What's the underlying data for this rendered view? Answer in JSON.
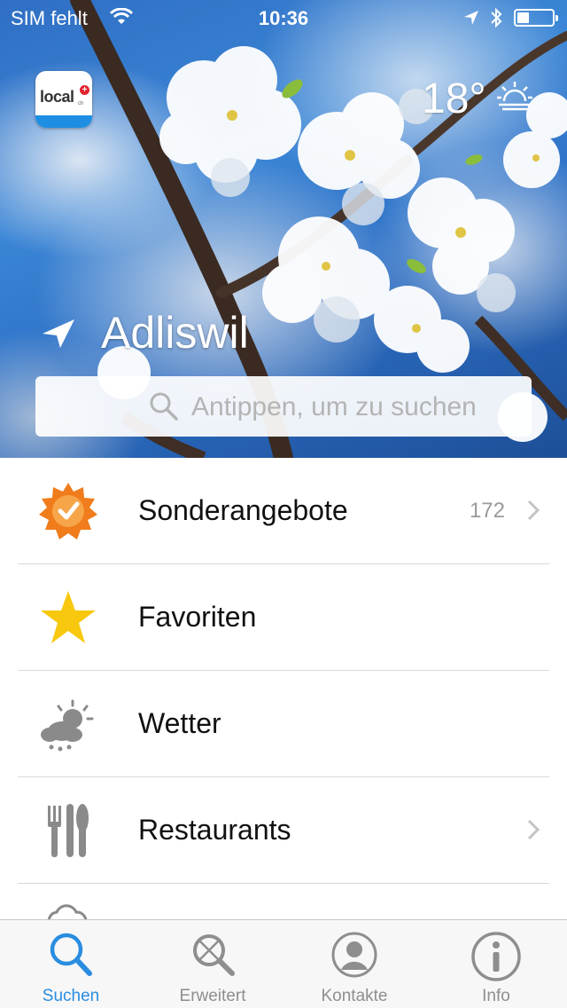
{
  "status_bar": {
    "carrier": "SIM fehlt",
    "time": "10:36",
    "battery_level": 0.35
  },
  "logo": {
    "text": "local",
    "sub": "ch"
  },
  "weather": {
    "temperature": "18°",
    "icon": "sunrise-icon"
  },
  "location": {
    "name": "Adliswil",
    "icon": "location-arrow-icon"
  },
  "search": {
    "placeholder": "Antippen, um zu suchen",
    "icon": "search-icon"
  },
  "list": {
    "items": [
      {
        "label": "Sonderangebote",
        "count": "172",
        "icon": "special-offer-badge-icon",
        "has_chevron": true
      },
      {
        "label": "Favoriten",
        "count": "",
        "icon": "star-icon",
        "has_chevron": false
      },
      {
        "label": "Wetter",
        "count": "",
        "icon": "weather-cloud-sun-icon",
        "has_chevron": false
      },
      {
        "label": "Restaurants",
        "count": "",
        "icon": "cutlery-icon",
        "has_chevron": true
      }
    ]
  },
  "tabbar": {
    "tabs": [
      {
        "label": "Suchen",
        "icon": "search-tab-icon",
        "active": true
      },
      {
        "label": "Erweitert",
        "icon": "advanced-search-icon",
        "active": false
      },
      {
        "label": "Kontakte",
        "icon": "contacts-icon",
        "active": false
      },
      {
        "label": "Info",
        "icon": "info-icon",
        "active": false
      }
    ]
  },
  "colors": {
    "accent": "#2a8de0",
    "offer_orange": "#f07c1c",
    "star_yellow": "#f7c80e",
    "icon_gray": "#8a8a8a"
  }
}
